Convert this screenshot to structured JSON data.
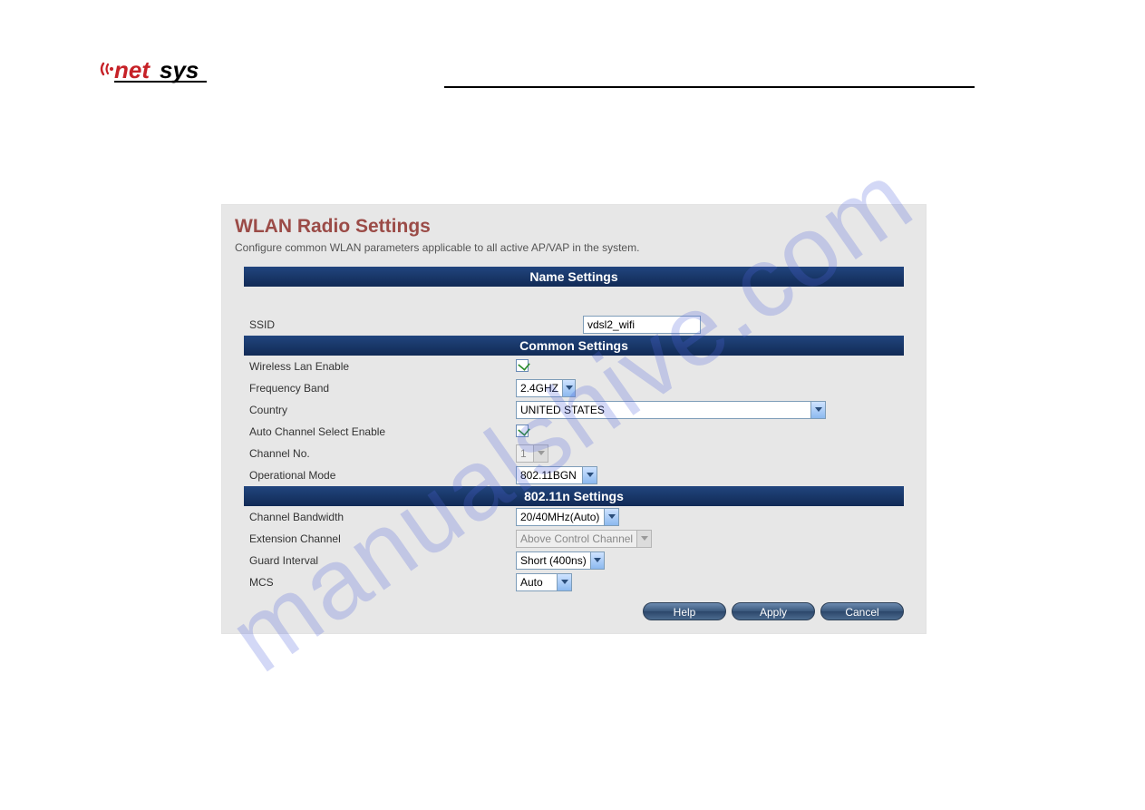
{
  "logo": {
    "brand_prefix": "net",
    "brand_suffix": "sys"
  },
  "watermark": "manualshive.com",
  "page": {
    "title": "WLAN Radio Settings",
    "description": "Configure common WLAN parameters applicable to all active AP/VAP in the system."
  },
  "sections": {
    "name": "Name Settings",
    "common": "Common Settings",
    "n": "802.11n Settings"
  },
  "fields": {
    "ssid": {
      "label": "SSID",
      "value": "vdsl2_wifi"
    },
    "wlan_enable": {
      "label": "Wireless Lan Enable",
      "checked": true
    },
    "freq_band": {
      "label": "Frequency Band",
      "value": "2.4GHZ"
    },
    "country": {
      "label": "Country",
      "value": "UNITED STATES"
    },
    "auto_ch_select": {
      "label": "Auto Channel Select Enable",
      "checked": true
    },
    "channel_no": {
      "label": "Channel No.",
      "value": "1",
      "disabled": true
    },
    "op_mode": {
      "label": "Operational Mode",
      "value": "802.11BGN"
    },
    "ch_bw": {
      "label": "Channel Bandwidth",
      "value": "20/40MHz(Auto)"
    },
    "ext_ch": {
      "label": "Extension Channel",
      "value": "Above Control Channel",
      "disabled": true
    },
    "guard_interval": {
      "label": "Guard Interval",
      "value": "Short (400ns)"
    },
    "mcs": {
      "label": "MCS",
      "value": "Auto"
    }
  },
  "buttons": {
    "help": "Help",
    "apply": "Apply",
    "cancel": "Cancel"
  }
}
